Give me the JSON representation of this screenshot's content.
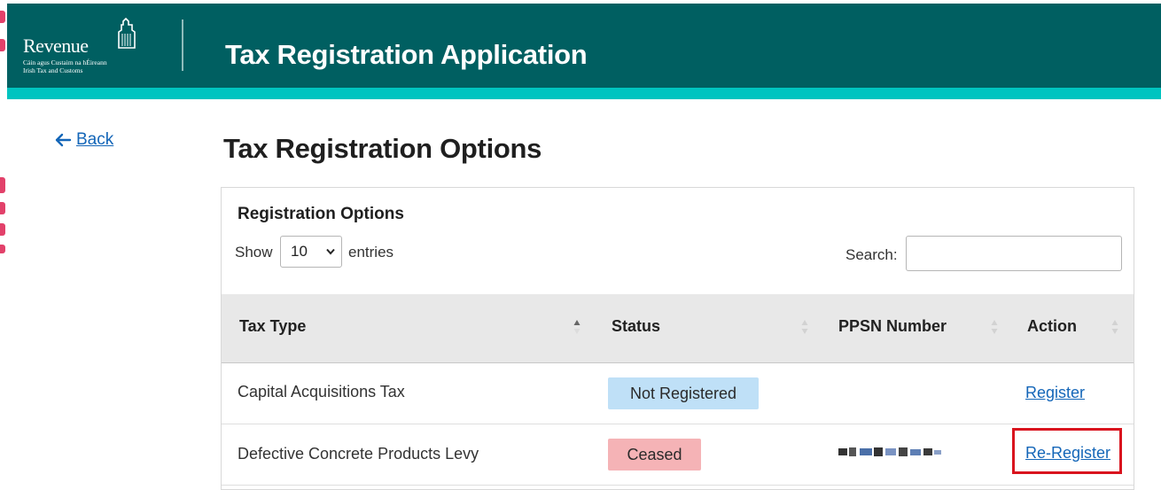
{
  "header": {
    "logo": {
      "name": "Revenue",
      "subtitle_irish": "Cáin agus Custaim na hÉireann",
      "subtitle_english": "Irish Tax and Customs"
    },
    "app_title": "Tax Registration Application"
  },
  "nav": {
    "back_label": "Back"
  },
  "page": {
    "title": "Tax Registration Options"
  },
  "card": {
    "title": "Registration Options",
    "show_label": "Show",
    "entries_value": "10",
    "entries_label": "entries",
    "search_label": "Search:",
    "search_value": ""
  },
  "table": {
    "columns": [
      "Tax Type",
      "Status",
      "PPSN Number",
      "Action"
    ],
    "rows": [
      {
        "tax_type": "Capital Acquisitions Tax",
        "status": "Not Registered",
        "ppsn": "",
        "action": "Register"
      },
      {
        "tax_type": "Defective Concrete Products Levy",
        "status": "Ceased",
        "ppsn": "",
        "action": "Re-Register"
      }
    ]
  },
  "colors": {
    "header_bg": "#005f61",
    "header_stripe": "#00c4c0",
    "link": "#1466b8",
    "badge_not_registered": "#bfe0f7",
    "badge_ceased": "#f5b3b6",
    "highlight": "#d9141e"
  },
  "icons": {
    "back": "arrow-left-icon",
    "select": "chevron-down-icon",
    "sort_active": "sort-asc-icon",
    "sort_inactive": "sort-both-icon",
    "logo": "harp-icon"
  }
}
